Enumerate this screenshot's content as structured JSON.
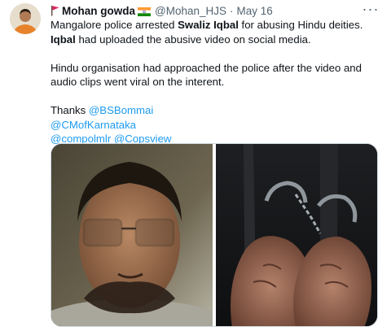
{
  "tweet": {
    "author_name": "Mohan gowda",
    "handle": "@Mohan_HJS",
    "separator": "·",
    "date": "May 16",
    "more_label": "···",
    "line1_pre": "Mangalore police arrested ",
    "line1_bold1": "Swaliz Iqbal",
    "line1_mid": " for abusing Hindu deities. ",
    "line1_bold2": "Iqbal",
    "line1_post": " had uploaded the abusive video on social media.",
    "para2": "Hindu organisation had approached the police after the video and audio clips went viral on the interent.",
    "thanks": "Thanks ",
    "mention1": "@BSBommai",
    "mention2": "@CMofKarnataka",
    "mention3": "@compolmlr",
    "mention4": "@Copsview"
  },
  "colors": {
    "link": "#1d9bf0",
    "text": "#0f1419",
    "secondary": "#536471",
    "red_flag": "#e0245e"
  },
  "icons": {
    "author_flag": "red-flag-icon",
    "name_emoji": "india-flag-icon",
    "more": "more-horizontal-icon"
  }
}
